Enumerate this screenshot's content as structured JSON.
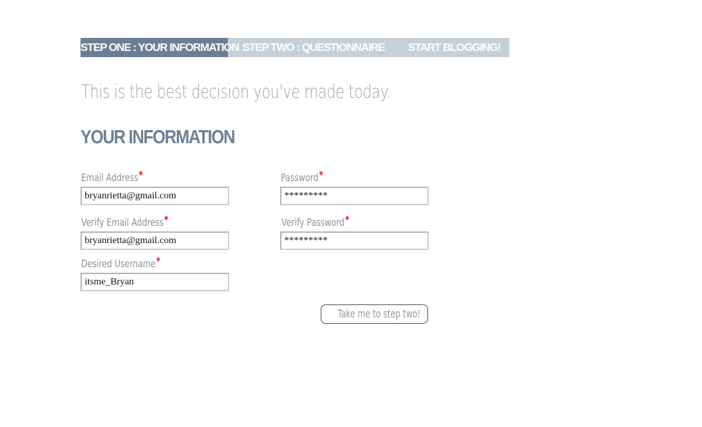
{
  "steps": {
    "step1": "STEP ONE : YOUR INFORMATION",
    "step2": "STEP TWO : QUESTIONNAIRE",
    "step3": "START BLOGGING!"
  },
  "tagline": "This is the best decision you've made today.",
  "section_title": "YOUR INFORMATION",
  "required_marker": "*",
  "form": {
    "email": {
      "label": "Email Address",
      "value": "bryanrietta@gmail.com"
    },
    "verify_email": {
      "label": "Verify Email Address",
      "value": "bryanrietta@gmail.com"
    },
    "username": {
      "label": "Desired Username",
      "value": "itsme_Bryan"
    },
    "password": {
      "label": "Password",
      "value": "*********"
    },
    "verify_password": {
      "label": "Verify Password",
      "value": "*********"
    }
  },
  "submit_label": "Take me to step two!",
  "colors": {
    "active_step": "#6a7f93",
    "inactive_steps": "#c8d0d7",
    "heading": "#6a8196",
    "label": "#8f8f8f",
    "required": "#e0141b"
  }
}
